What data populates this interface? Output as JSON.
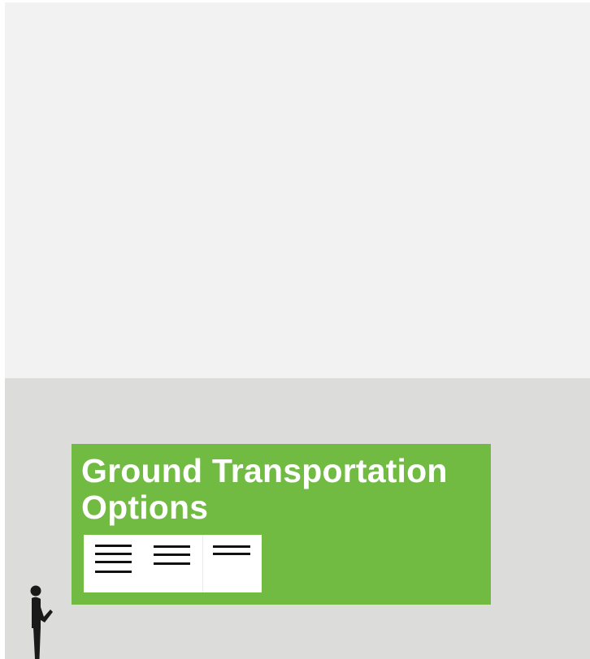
{
  "scene": {
    "colors": {
      "ceiling": "#f1f2f1",
      "wall": "#dcdcdb",
      "sign": "#72bb43",
      "sign_text": "#ffffff",
      "panel": "#ffffff",
      "lines": "#111111"
    }
  },
  "sign": {
    "title_line1": "Ground Transportation",
    "title_line2": "Options",
    "panel_columns": [
      {
        "line_count": 4
      },
      {
        "line_count": 3
      },
      {
        "line_count": 2
      }
    ]
  },
  "person": {
    "icon": "person-reading-icon"
  }
}
